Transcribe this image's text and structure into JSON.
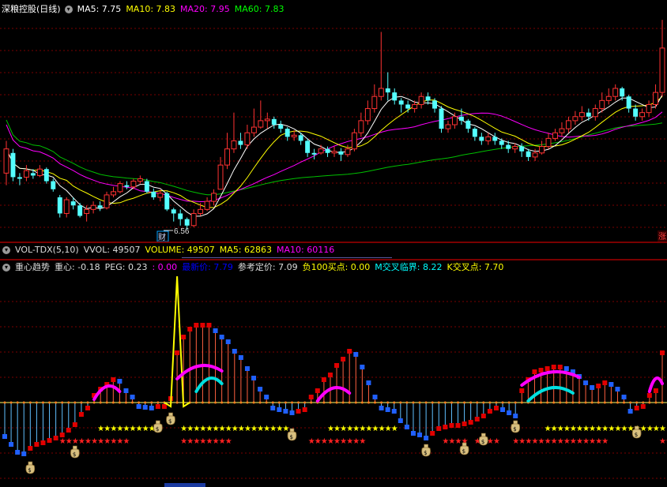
{
  "main_header": {
    "title": "深粮控股(日线)",
    "ma5": "MA5: 7.75",
    "ma10": "MA10: 7.83",
    "ma20": "MA20: 7.95",
    "ma60": "MA60: 7.83",
    "colors": {
      "title": "#ffffff",
      "ma5": "#ffffff",
      "ma10": "#ffff00",
      "ma20": "#ff00ff",
      "ma60": "#00ff00"
    }
  },
  "price_annotation": {
    "low_price": "6.56",
    "badge": "财",
    "right_badge": "涨"
  },
  "vol_header": {
    "name": "VOL-TDX(5,10)",
    "vvol": "VVOL: 49507",
    "volume": "VOLUME: 49507",
    "ma5": "MA5: 62863",
    "ma10": "MA10: 60116"
  },
  "ind_header": {
    "name": "重心趋势",
    "zx": "重心: -0.18",
    "peg": "PEG: 0.23",
    "blank": ": 0.00",
    "latest": "最新价: 7.79",
    "ref_price": "参考定价: 7.09",
    "neg100": "负100买点: 0.00",
    "m_cross": "M交叉临界: 8.22",
    "k_cross": "K交叉点: 7.70"
  },
  "icons": {
    "dropdown": "chevron-down-icon",
    "money_bag": "money-bag-icon",
    "star": "star-icon"
  },
  "candles": [
    {
      "o": 7.05,
      "c": 7.35,
      "h": 7.45,
      "l": 6.9
    },
    {
      "o": 7.3,
      "c": 7.0,
      "h": 7.35,
      "l": 6.95
    },
    {
      "o": 7.0,
      "c": 6.98,
      "h": 7.05,
      "l": 6.9
    },
    {
      "o": 7.0,
      "c": 7.08,
      "h": 7.15,
      "l": 6.95
    },
    {
      "o": 7.05,
      "c": 7.02,
      "h": 7.1,
      "l": 6.98
    },
    {
      "o": 7.02,
      "c": 7.1,
      "h": 7.15,
      "l": 7.0
    },
    {
      "o": 7.1,
      "c": 6.95,
      "h": 7.12,
      "l": 6.92
    },
    {
      "o": 6.95,
      "c": 6.85,
      "h": 6.98,
      "l": 6.82
    },
    {
      "o": 6.75,
      "c": 6.55,
      "h": 6.78,
      "l": 6.5
    },
    {
      "o": 6.55,
      "c": 6.72,
      "h": 6.75,
      "l": 6.5
    },
    {
      "o": 6.7,
      "c": 6.65,
      "h": 6.75,
      "l": 6.6
    },
    {
      "o": 6.65,
      "c": 6.52,
      "h": 6.68,
      "l": 6.5
    },
    {
      "o": 6.55,
      "c": 6.6,
      "h": 6.65,
      "l": 6.45
    },
    {
      "o": 6.6,
      "c": 6.65,
      "h": 6.7,
      "l": 6.55
    },
    {
      "o": 6.65,
      "c": 6.62,
      "h": 6.7,
      "l": 6.58
    },
    {
      "o": 6.62,
      "c": 6.78,
      "h": 6.82,
      "l": 6.6
    },
    {
      "o": 6.78,
      "c": 6.82,
      "h": 6.88,
      "l": 6.75
    },
    {
      "o": 6.82,
      "c": 6.92,
      "h": 6.95,
      "l": 6.8
    },
    {
      "o": 6.9,
      "c": 6.88,
      "h": 6.95,
      "l": 6.85
    },
    {
      "o": 6.88,
      "c": 6.95,
      "h": 6.98,
      "l": 6.85
    },
    {
      "o": 6.95,
      "c": 6.98,
      "h": 7.02,
      "l": 6.92
    },
    {
      "o": 6.95,
      "c": 6.82,
      "h": 6.98,
      "l": 6.8
    },
    {
      "o": 6.82,
      "c": 6.75,
      "h": 6.86,
      "l": 6.72
    },
    {
      "o": 6.75,
      "c": 6.8,
      "h": 6.85,
      "l": 6.7
    },
    {
      "o": 6.8,
      "c": 6.6,
      "h": 6.82,
      "l": 6.58
    },
    {
      "o": 6.6,
      "c": 6.55,
      "h": 6.62,
      "l": 6.45
    },
    {
      "o": 6.55,
      "c": 6.48,
      "h": 6.6,
      "l": 6.4
    },
    {
      "o": 6.48,
      "c": 6.4,
      "h": 6.5,
      "l": 6.35
    },
    {
      "o": 6.4,
      "c": 6.55,
      "h": 6.6,
      "l": 6.38
    },
    {
      "o": 6.55,
      "c": 6.6,
      "h": 6.68,
      "l": 6.52
    },
    {
      "o": 6.6,
      "c": 6.7,
      "h": 6.75,
      "l": 6.58
    },
    {
      "o": 6.7,
      "c": 6.8,
      "h": 6.85,
      "l": 6.65
    },
    {
      "o": 6.85,
      "c": 7.15,
      "h": 7.25,
      "l": 6.85
    },
    {
      "o": 7.15,
      "c": 7.35,
      "h": 7.55,
      "l": 7.1
    },
    {
      "o": 7.35,
      "c": 7.45,
      "h": 7.8,
      "l": 7.3
    },
    {
      "o": 7.45,
      "c": 7.4,
      "h": 7.55,
      "l": 7.35
    },
    {
      "o": 7.4,
      "c": 7.55,
      "h": 7.65,
      "l": 7.35
    },
    {
      "o": 7.55,
      "c": 7.62,
      "h": 7.85,
      "l": 7.5
    },
    {
      "o": 7.62,
      "c": 7.7,
      "h": 7.95,
      "l": 7.6
    },
    {
      "o": 7.7,
      "c": 7.72,
      "h": 7.8,
      "l": 7.6
    },
    {
      "o": 7.72,
      "c": 7.65,
      "h": 7.75,
      "l": 7.6
    },
    {
      "o": 7.65,
      "c": 7.6,
      "h": 7.7,
      "l": 7.55
    },
    {
      "o": 7.6,
      "c": 7.5,
      "h": 7.62,
      "l": 7.45
    },
    {
      "o": 7.5,
      "c": 7.52,
      "h": 7.58,
      "l": 7.45
    },
    {
      "o": 7.52,
      "c": 7.45,
      "h": 7.55,
      "l": 7.4
    },
    {
      "o": 7.45,
      "c": 7.3,
      "h": 7.48,
      "l": 7.25
    },
    {
      "o": 7.3,
      "c": 7.28,
      "h": 7.35,
      "l": 7.22
    },
    {
      "o": 7.3,
      "c": 7.35,
      "h": 7.4,
      "l": 7.28
    },
    {
      "o": 7.35,
      "c": 7.3,
      "h": 7.38,
      "l": 7.25
    },
    {
      "o": 7.3,
      "c": 7.32,
      "h": 7.38,
      "l": 7.25
    },
    {
      "o": 7.32,
      "c": 7.28,
      "h": 7.36,
      "l": 7.2
    },
    {
      "o": 7.28,
      "c": 7.35,
      "h": 7.4,
      "l": 7.25
    },
    {
      "o": 7.35,
      "c": 7.55,
      "h": 7.6,
      "l": 7.32
    },
    {
      "o": 7.55,
      "c": 7.7,
      "h": 7.8,
      "l": 7.5
    },
    {
      "o": 7.7,
      "c": 7.85,
      "h": 7.95,
      "l": 7.65
    },
    {
      "o": 7.85,
      "c": 8.0,
      "h": 8.15,
      "l": 7.8
    },
    {
      "o": 8.0,
      "c": 8.1,
      "h": 8.8,
      "l": 7.95
    },
    {
      "o": 8.1,
      "c": 8.05,
      "h": 8.3,
      "l": 7.95
    },
    {
      "o": 8.05,
      "c": 7.95,
      "h": 8.1,
      "l": 7.9
    },
    {
      "o": 7.95,
      "c": 7.9,
      "h": 7.98,
      "l": 7.8
    },
    {
      "o": 7.9,
      "c": 7.85,
      "h": 7.95,
      "l": 7.8
    },
    {
      "o": 7.85,
      "c": 7.9,
      "h": 7.95,
      "l": 7.8
    },
    {
      "o": 7.9,
      "c": 8.0,
      "h": 8.05,
      "l": 7.85
    },
    {
      "o": 8.0,
      "c": 7.95,
      "h": 8.05,
      "l": 7.9
    },
    {
      "o": 7.95,
      "c": 7.85,
      "h": 7.98,
      "l": 7.8
    },
    {
      "o": 7.85,
      "c": 7.6,
      "h": 7.88,
      "l": 7.55
    },
    {
      "o": 7.6,
      "c": 7.65,
      "h": 7.7,
      "l": 7.55
    },
    {
      "o": 7.65,
      "c": 7.75,
      "h": 7.8,
      "l": 7.6
    },
    {
      "o": 7.75,
      "c": 7.7,
      "h": 7.85,
      "l": 7.65
    },
    {
      "o": 7.7,
      "c": 7.6,
      "h": 7.72,
      "l": 7.55
    },
    {
      "o": 7.6,
      "c": 7.5,
      "h": 7.62,
      "l": 7.45
    },
    {
      "o": 7.5,
      "c": 7.45,
      "h": 7.55,
      "l": 7.4
    },
    {
      "o": 7.45,
      "c": 7.5,
      "h": 7.55,
      "l": 7.4
    },
    {
      "o": 7.5,
      "c": 7.45,
      "h": 7.55,
      "l": 7.4
    },
    {
      "o": 7.45,
      "c": 7.4,
      "h": 7.48,
      "l": 7.35
    },
    {
      "o": 7.4,
      "c": 7.35,
      "h": 7.45,
      "l": 7.3
    },
    {
      "o": 7.35,
      "c": 7.38,
      "h": 7.42,
      "l": 7.3
    },
    {
      "o": 7.38,
      "c": 7.32,
      "h": 7.42,
      "l": 7.25
    },
    {
      "o": 7.32,
      "c": 7.25,
      "h": 7.35,
      "l": 7.2
    },
    {
      "o": 7.25,
      "c": 7.3,
      "h": 7.35,
      "l": 7.2
    },
    {
      "o": 7.3,
      "c": 7.38,
      "h": 7.45,
      "l": 7.28
    },
    {
      "o": 7.38,
      "c": 7.48,
      "h": 7.55,
      "l": 7.35
    },
    {
      "o": 7.48,
      "c": 7.55,
      "h": 7.6,
      "l": 7.45
    },
    {
      "o": 7.55,
      "c": 7.6,
      "h": 7.68,
      "l": 7.5
    },
    {
      "o": 7.6,
      "c": 7.7,
      "h": 7.75,
      "l": 7.55
    },
    {
      "o": 7.7,
      "c": 7.75,
      "h": 7.82,
      "l": 7.65
    },
    {
      "o": 7.75,
      "c": 7.8,
      "h": 7.88,
      "l": 7.7
    },
    {
      "o": 7.8,
      "c": 7.75,
      "h": 7.85,
      "l": 7.7
    },
    {
      "o": 7.75,
      "c": 7.85,
      "h": 7.9,
      "l": 7.7
    },
    {
      "o": 7.85,
      "c": 7.95,
      "h": 8.05,
      "l": 7.8
    },
    {
      "o": 7.95,
      "c": 8.0,
      "h": 8.1,
      "l": 7.9
    },
    {
      "o": 8.0,
      "c": 8.1,
      "h": 8.15,
      "l": 7.95
    },
    {
      "o": 8.1,
      "c": 8.0,
      "h": 8.12,
      "l": 7.95
    },
    {
      "o": 8.0,
      "c": 7.85,
      "h": 8.02,
      "l": 7.8
    },
    {
      "o": 7.85,
      "c": 7.75,
      "h": 7.9,
      "l": 7.7
    },
    {
      "o": 7.75,
      "c": 7.8,
      "h": 7.85,
      "l": 7.7
    },
    {
      "o": 7.8,
      "c": 7.9,
      "h": 7.95,
      "l": 7.75
    },
    {
      "o": 7.9,
      "c": 8.05,
      "h": 8.15,
      "l": 7.85
    },
    {
      "o": 8.05,
      "c": 8.6,
      "h": 8.95,
      "l": 8.0
    }
  ],
  "indicator_bars": [
    -40,
    -50,
    -60,
    -62,
    -55,
    -50,
    -48,
    -45,
    -42,
    -38,
    -32,
    -25,
    -12,
    -4,
    6,
    14,
    20,
    26,
    24,
    12,
    4,
    -2,
    -3,
    -4,
    -2,
    -2,
    2,
    60,
    80,
    90,
    95,
    95,
    95,
    88,
    80,
    74,
    62,
    54,
    40,
    28,
    14,
    4,
    -4,
    -6,
    -8,
    -10,
    -8,
    -6,
    4,
    12,
    26,
    32,
    44,
    52,
    62,
    58,
    42,
    22,
    4,
    -4,
    -6,
    -8,
    -20,
    -28,
    -36,
    -38,
    -42,
    -36,
    -30,
    -28,
    -26,
    -26,
    -24,
    -22,
    -18,
    -14,
    -8,
    -4,
    -6,
    -10,
    -14,
    12,
    26,
    36,
    38,
    40,
    42,
    42,
    40,
    36,
    30,
    22,
    16,
    18,
    22,
    20,
    14,
    4,
    -8,
    -4,
    -2,
    6,
    12,
    60
  ]
}
